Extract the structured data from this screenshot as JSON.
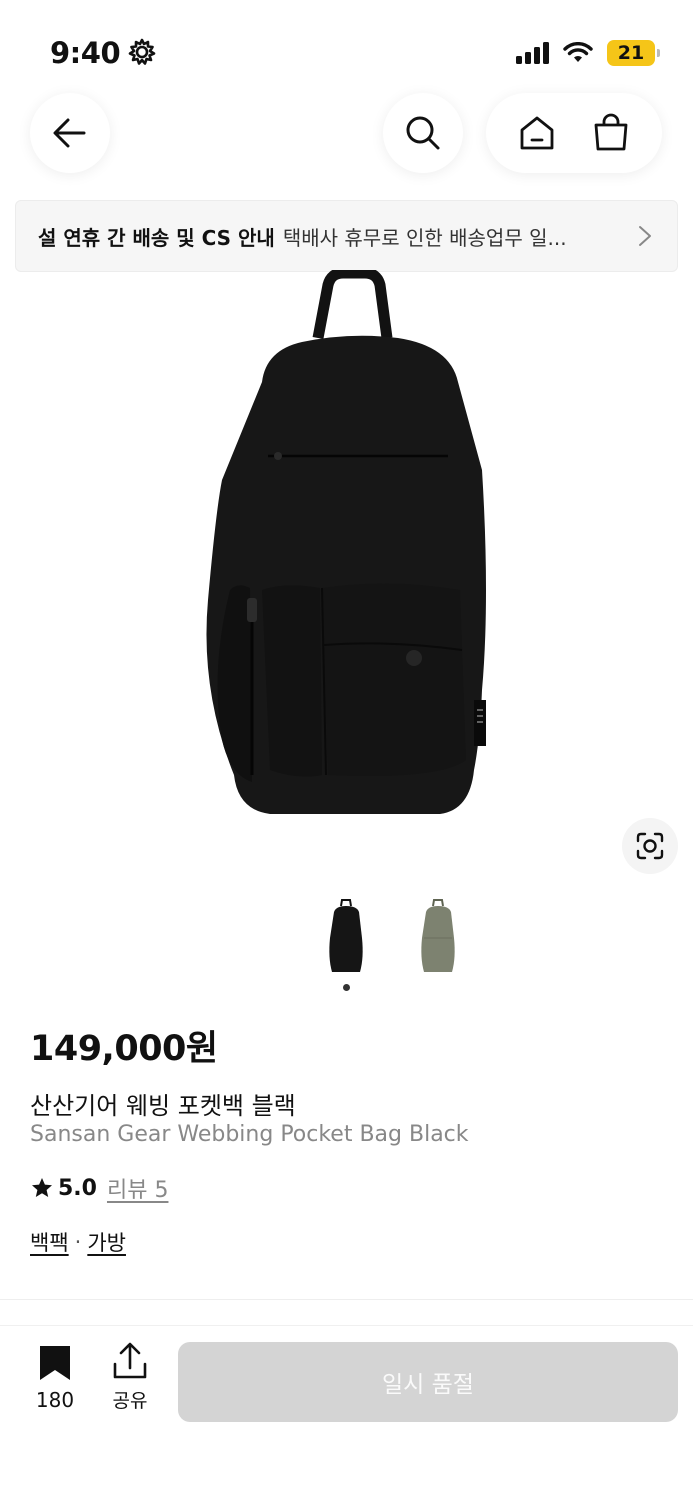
{
  "status_bar": {
    "time": "9:40",
    "battery": "21"
  },
  "nav": {
    "back_icon": "arrow-left-icon",
    "search_icon": "search-icon",
    "home_icon": "home-icon",
    "cart_icon": "shopping-bag-icon"
  },
  "notice": {
    "title": "설 연휴 간 배송 및 CS 안내",
    "text": "택배사 휴무로 인한 배송업무 일..."
  },
  "product": {
    "thumbnails": [
      "black",
      "olive"
    ],
    "price": "149,000원",
    "name_ko": "산산기어 웨빙 포켓백 블랙",
    "name_en": "Sansan Gear Webbing Pocket Bag Black",
    "rating": "5.0",
    "review_label": "리뷰 5",
    "categories": [
      "백팩",
      "가방"
    ],
    "category_separator": "·"
  },
  "bottom_bar": {
    "bookmark_count": "180",
    "share_label": "공유",
    "soldout_label": "일시 품절"
  },
  "colors": {
    "battery": "#f5c518",
    "soldout_button": "#d4d4d4",
    "notice_bg": "#f6f6f6"
  }
}
